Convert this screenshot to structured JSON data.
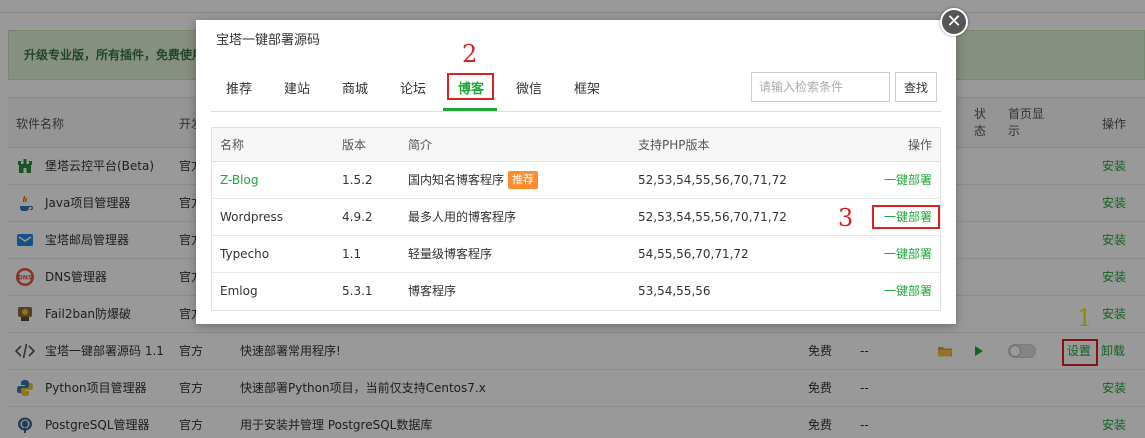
{
  "background": {
    "promo_text": "升级专业版，所有插件，免费使用",
    "headers": {
      "name": "软件名称",
      "dev": "开发",
      "status": "状态",
      "home_display": "首页显示",
      "action": "操作"
    },
    "rows": [
      {
        "icon": "castle-icon",
        "name": "堡塔云控平台(Beta)",
        "dev": "官方",
        "desc": "",
        "price": "",
        "expire": "",
        "action": "安装"
      },
      {
        "icon": "java-icon",
        "name": "Java项目管理器",
        "dev": "官方",
        "desc": "",
        "price": "",
        "expire": "",
        "action": "安装"
      },
      {
        "icon": "mail-icon",
        "name": "宝塔邮局管理器",
        "dev": "官方",
        "desc": "",
        "price": "",
        "expire": "",
        "action": "安装"
      },
      {
        "icon": "dns-icon",
        "name": "DNS管理器",
        "dev": "官方",
        "desc": "",
        "price": "",
        "expire": "",
        "action": "安装"
      },
      {
        "icon": "fail2ban-icon",
        "name": "Fail2ban防爆破",
        "dev": "官方",
        "desc": "",
        "price": "",
        "expire": "",
        "action": "安装"
      },
      {
        "icon": "code-icon",
        "name": "宝塔一键部署源码 1.1",
        "dev": "官方",
        "desc": "快速部署常用程序!",
        "price": "免费",
        "expire": "--",
        "settings": "设置",
        "uninstall": "卸载"
      },
      {
        "icon": "python-icon",
        "name": "Python项目管理器",
        "dev": "官方",
        "desc": "快速部署Python项目，当前仅支持Centos7.x",
        "price": "免费",
        "expire": "--",
        "action": "安装"
      },
      {
        "icon": "postgresql-icon",
        "name": "PostgreSQL管理器",
        "dev": "官方",
        "desc": "用于安装并管理 PostgreSQL数据库",
        "price": "免费",
        "expire": "--",
        "action": "安装"
      }
    ]
  },
  "modal": {
    "title": "宝塔一键部署源码",
    "close_symbol": "✕",
    "tabs": [
      "推荐",
      "建站",
      "商城",
      "论坛",
      "博客",
      "微信",
      "框架"
    ],
    "active_tab": "博客",
    "search": {
      "placeholder": "请输入检索条件",
      "button": "查找"
    },
    "table": {
      "headers": {
        "name": "名称",
        "version": "版本",
        "desc": "简介",
        "php": "支持PHP版本",
        "op": "操作"
      },
      "rows": [
        {
          "name": "Z-Blog",
          "version": "1.5.2",
          "desc": "国内知名博客程序",
          "badge": "推荐",
          "php": "52,53,54,55,56,70,71,72",
          "op": "一键部署"
        },
        {
          "name": "Wordpress",
          "version": "4.9.2",
          "desc": "最多人用的博客程序",
          "php": "52,53,54,55,56,70,71,72",
          "op": "一键部署"
        },
        {
          "name": "Typecho",
          "version": "1.1",
          "desc": "轻量级博客程序",
          "php": "54,55,56,70,71,72",
          "op": "一键部署"
        },
        {
          "name": "Emlog",
          "version": "5.3.1",
          "desc": "博客程序",
          "php": "53,54,55,56",
          "op": "一键部署"
        }
      ]
    }
  },
  "annotations": {
    "step1": "1",
    "step2": "2",
    "step3": "3"
  },
  "colors": {
    "accent_green": "#20a53a",
    "annotation_red": "#e02020",
    "annotation_yellow": "#f5e60a",
    "badge_orange": "#ff8b2c"
  }
}
